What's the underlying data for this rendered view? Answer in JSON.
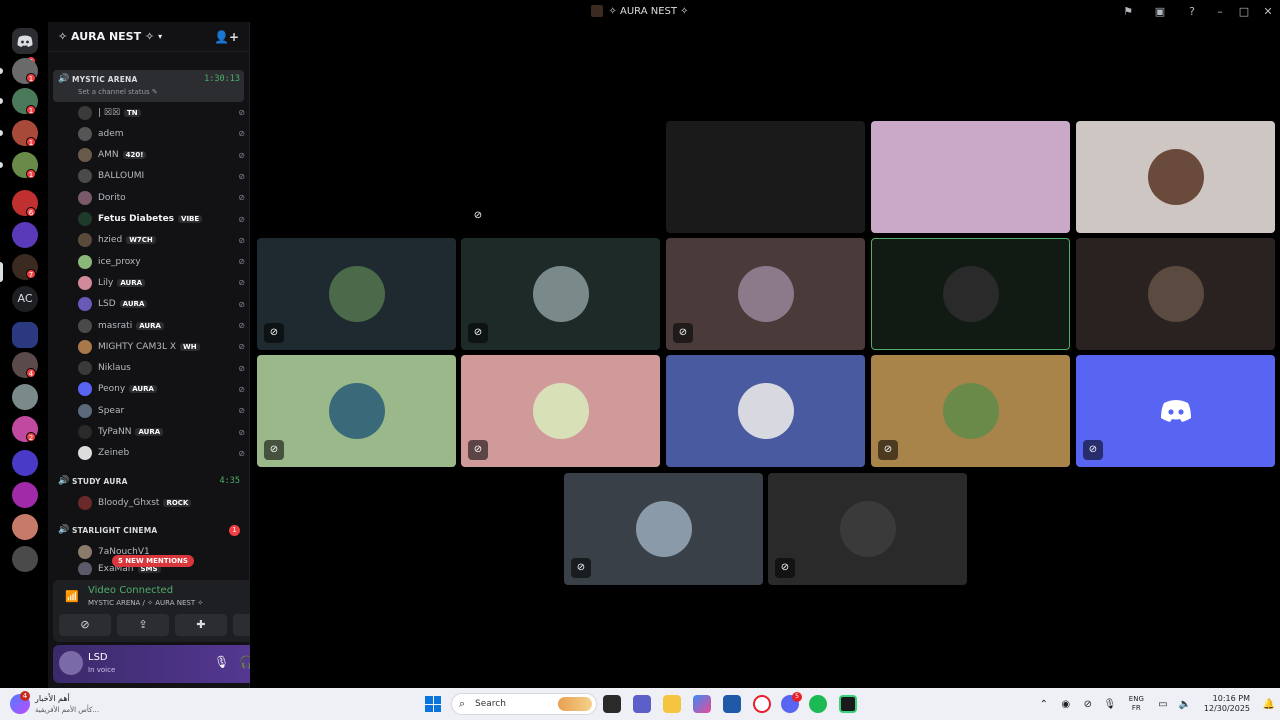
{
  "window": {
    "title": "✧ AURA NEST ✧",
    "controls": [
      "inbox-icon",
      "help-icon",
      "minimize",
      "maximize",
      "close"
    ]
  },
  "guilds": {
    "badges": [
      "2",
      "1",
      "1",
      "1",
      "1",
      "6",
      "7",
      "4",
      "2"
    ],
    "text_server": "AC"
  },
  "server": {
    "name": "✧ AURA NEST ✧",
    "active_channel": {
      "name": "MYSTIC ARENA",
      "timer": "1:30:13",
      "status_prompt": "Set a channel status"
    },
    "members": [
      {
        "name": "| ☒☒",
        "tag": "TN",
        "color": "#3a3a3a"
      },
      {
        "name": "adem",
        "tag": "",
        "color": "#555"
      },
      {
        "name": "AMN",
        "tag": "420!",
        "color": "#6a5a4a"
      },
      {
        "name": "BALLOUMI",
        "tag": "",
        "color": "#4a4a4a"
      },
      {
        "name": "Dorito",
        "tag": "",
        "color": "#7a5a6a"
      },
      {
        "name": "Fetus Diabetes",
        "tag": "VIBE",
        "color": "#1e3a2a"
      },
      {
        "name": "hzied",
        "tag": "W7CH",
        "color": "#5a4a3a"
      },
      {
        "name": "ice_proxy",
        "tag": "",
        "color": "#8ab87a"
      },
      {
        "name": "Lily",
        "tag": "AURA",
        "color": "#d08a9a"
      },
      {
        "name": "LSD",
        "tag": "AURA",
        "color": "#6a5ab8"
      },
      {
        "name": "masrati",
        "tag": "AURA",
        "color": "#4a4a4a"
      },
      {
        "name": "MIGHTY CAM3L X",
        "tag": "WH",
        "color": "#a8784a"
      },
      {
        "name": "Niklaus",
        "tag": "",
        "color": "#3a3a3a"
      },
      {
        "name": "Peony",
        "tag": "AURA",
        "color": "#5865f2"
      },
      {
        "name": "Spear",
        "tag": "",
        "color": "#5a6a7a"
      },
      {
        "name": "TyPaNN",
        "tag": "AURA",
        "color": "#2a2a2a"
      },
      {
        "name": "Zeineb",
        "tag": "",
        "color": "#dcdcdc"
      }
    ],
    "study_channel": {
      "name": "STUDY AURA",
      "timer": "4:35",
      "member": "Bloody_Ghxst",
      "tag": "ROCK"
    },
    "cinema_channel": {
      "name": "STARLIGHT CINEMA",
      "badge": "1",
      "members": [
        "7aNouchV1",
        "ExaMan"
      ],
      "tag": "SMS"
    },
    "mentions_pill": "5 NEW MENTIONS"
  },
  "voice_panel": {
    "title": "Video Connected",
    "subtitle": "MYSTIC ARENA / ✧ AURA NEST ✧"
  },
  "user_panel": {
    "name": "LSD",
    "status": "In voice"
  },
  "tiles": [
    {
      "bg": "#000000",
      "avatar": "",
      "muted": true
    },
    {
      "bg": "#1a1a1a",
      "avatar": "",
      "muted": false
    },
    {
      "bg": "#c9a8c8",
      "avatar": "",
      "muted": false
    },
    {
      "bg": "#cdc6c2",
      "avatar": "#6a4a3a",
      "muted": false
    },
    {
      "bg": "#1e2a30",
      "avatar": "#4a6a4a",
      "muted": true
    },
    {
      "bg": "#1e2a28",
      "avatar": "#7a8a8a",
      "muted": true
    },
    {
      "bg": "#4a3a3a",
      "avatar": "#8a7a8a",
      "muted": true
    },
    {
      "bg": "#121a14",
      "avatar": "#2a2a2a",
      "muted": false
    },
    {
      "bg": "#2a2220",
      "avatar": "#5a4a40",
      "muted": false
    },
    {
      "bg": "#9ab88a",
      "avatar": "#3a6a7a",
      "muted": true
    },
    {
      "bg": "#d09a9a",
      "avatar": "#d8e0b8",
      "muted": true
    },
    {
      "bg": "#4a5aa0",
      "avatar": "#d8d8e0",
      "muted": false
    },
    {
      "bg": "#a8844a",
      "avatar": "#6a8a4a",
      "muted": true
    },
    {
      "bg": "#5865f2",
      "avatar": "",
      "muted": true
    },
    {
      "bg": "#3a4048",
      "avatar": "#8a9aa8",
      "muted": true
    },
    {
      "bg": "#2a2a2a",
      "avatar": "#3a3a3a",
      "muted": true
    },
    {
      "bg": "#e8e8e8",
      "avatar": "#ffffff",
      "muted": false
    }
  ],
  "taskbar": {
    "news_count": "4",
    "news_title": "أهم الأخبار",
    "news_sub": "كأس الأمم الأفريقية...",
    "search_placeholder": "Search",
    "discord_badge": "5",
    "lang_top": "ENG",
    "lang_bottom": "FR",
    "time": "10:16 PM",
    "date": "12/30/2025"
  }
}
